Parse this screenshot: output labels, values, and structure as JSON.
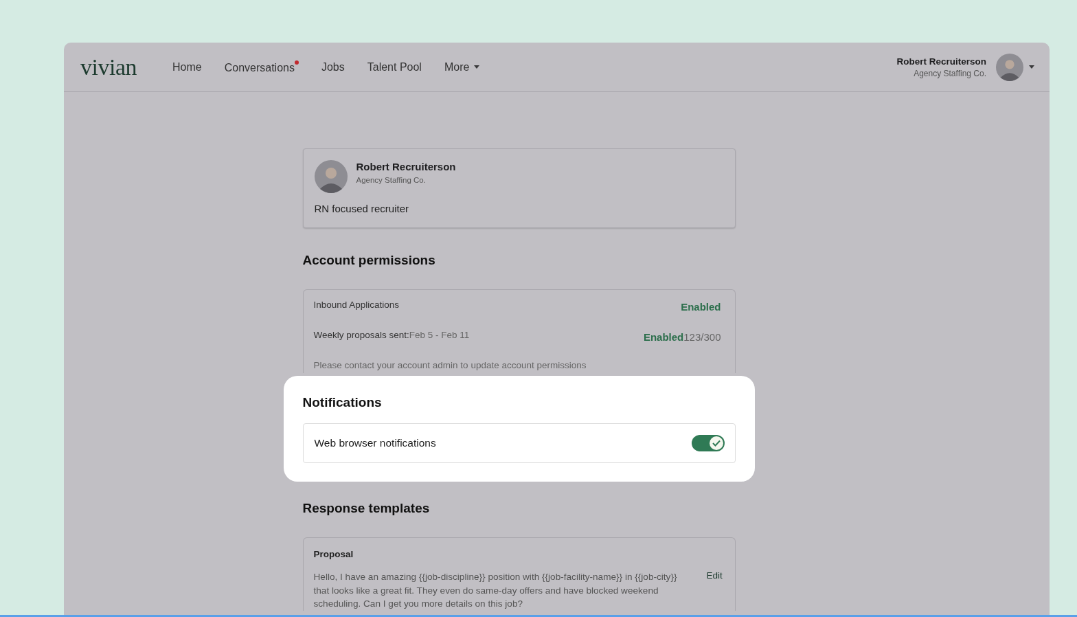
{
  "nav": {
    "logo": "vivian",
    "items": [
      {
        "label": "Home",
        "unread": false,
        "dropdown": false
      },
      {
        "label": "Conversations",
        "unread": true,
        "dropdown": false
      },
      {
        "label": "Jobs",
        "unread": false,
        "dropdown": false
      },
      {
        "label": "Talent Pool",
        "unread": false,
        "dropdown": false
      },
      {
        "label": "More",
        "unread": false,
        "dropdown": true
      }
    ],
    "user": {
      "name": "Robert Recruiterson",
      "company": "Agency Staffing Co."
    }
  },
  "profile": {
    "name": "Robert Recruiterson",
    "company": "Agency Staffing Co.",
    "bio": "RN focused recruiter"
  },
  "permissions": {
    "title": "Account permissions",
    "rows": [
      {
        "label": "Inbound Applications",
        "status": "Enabled"
      },
      {
        "label": "Weekly proposals sent:",
        "detail": "Feb 5 - Feb 11",
        "status": "Enabled",
        "count": "123/300"
      }
    ],
    "note": "Please contact your account admin to update account permissions"
  },
  "notifications": {
    "title": "Notifications",
    "items": [
      {
        "label": "Web browser notifications",
        "on": true
      }
    ]
  },
  "templates": {
    "title": "Response templates",
    "items": [
      {
        "name": "Proposal",
        "body": "Hello, I have an amazing {{job-discipline}} position with {{job-facility-name}} in {{job-city}} that looks like a great fit. They even do same-day offers and have blocked weekend scheduling. Can I get you more details on this job?",
        "action": "Edit"
      }
    ]
  }
}
